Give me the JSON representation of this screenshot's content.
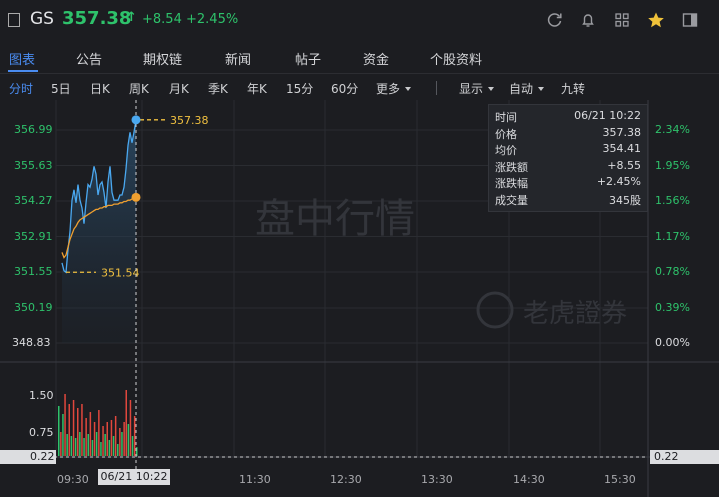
{
  "header": {
    "symbol": "GS",
    "price": "357.38",
    "arrow": "↑",
    "change": "+8.54",
    "change_pct": "+2.45%"
  },
  "tabs": [
    "图表",
    "公告",
    "期权链",
    "新闻",
    "帖子",
    "资金",
    "个股资料"
  ],
  "toolbar": {
    "periods": [
      "分时",
      "5日",
      "日K",
      "周K",
      "月K",
      "季K",
      "年K",
      "15分",
      "60分",
      "更多"
    ],
    "display": "显示",
    "auto": "自动",
    "nine": "九转"
  },
  "watermark": {
    "main": "盘中行情",
    "brand": "老虎證券"
  },
  "y_axis_left": [
    "356.99",
    "355.63",
    "354.27",
    "352.91",
    "351.55",
    "350.19",
    "348.83"
  ],
  "y_axis_right": [
    "2.34%",
    "1.95%",
    "1.56%",
    "1.17%",
    "0.78%",
    "0.39%",
    "0.00%"
  ],
  "volume_axis": [
    "1.50",
    "0.75",
    "0.22"
  ],
  "volume_right": "0.22",
  "x_axis": [
    "09:30",
    "11:30",
    "12:30",
    "13:30",
    "14:30",
    "15:30"
  ],
  "cursor_time": "06/21 10:22",
  "high_marker": "357.38",
  "low_marker": "351.54",
  "info_panel": [
    {
      "k": "时间",
      "v": "06/21 10:22"
    },
    {
      "k": "价格",
      "v": "357.38"
    },
    {
      "k": "均价",
      "v": "354.41"
    },
    {
      "k": "涨跌额",
      "v": "+8.55"
    },
    {
      "k": "涨跌幅",
      "v": "+2.45%"
    },
    {
      "k": "成交量",
      "v": "345股"
    }
  ],
  "chart_data": {
    "type": "line",
    "prev_close": 348.83,
    "ylim": [
      348.83,
      357.7
    ],
    "price": [
      351.9,
      351.6,
      351.54,
      352.4,
      353.1,
      354.3,
      354.7,
      354.2,
      354.9,
      354.3,
      354.0,
      353.4,
      354.2,
      354.9,
      354.8,
      355.1,
      355.6,
      355.3,
      354.5,
      354.9,
      355.0,
      354.6,
      354.0,
      355.0,
      355.6,
      354.6,
      354.3,
      354.3,
      354.3,
      354.5,
      354.5,
      354.8,
      355.5,
      356.4,
      356.9,
      356.5,
      356.9,
      357.38
    ],
    "avg": [
      352.3,
      352.1,
      352.2,
      352.5,
      352.8,
      353.0,
      353.2,
      353.3,
      353.45,
      353.55,
      353.6,
      353.65,
      353.7,
      353.75,
      353.8,
      353.85,
      353.9,
      353.95,
      353.95,
      354.0,
      354.0,
      354.05,
      354.05,
      354.1,
      354.1,
      354.1,
      354.15,
      354.15,
      354.15,
      354.2,
      354.2,
      354.25,
      354.25,
      354.3,
      354.3,
      354.35,
      354.38,
      354.41
    ],
    "volume": [
      1.25,
      0.6,
      1.05,
      1.55,
      0.55,
      1.3,
      0.5,
      1.4,
      0.45,
      1.2,
      0.6,
      1.3,
      0.45,
      0.95,
      0.55,
      1.1,
      0.4,
      0.85,
      0.6,
      1.15,
      0.35,
      0.75,
      0.55,
      0.85,
      0.4,
      0.9,
      0.5,
      1.0,
      0.3,
      0.7,
      0.6,
      0.85,
      1.65,
      0.8,
      1.4,
      0.5,
      1.0,
      0.22
    ],
    "volume_colors": [
      "#2ec26b",
      "#e0473d",
      "#2ec26b",
      "#e0473d",
      "#2ec26b",
      "#e0473d",
      "#2ec26b",
      "#e0473d",
      "#2ec26b",
      "#e0473d",
      "#2ec26b",
      "#e0473d",
      "#2ec26b",
      "#e0473d",
      "#2ec26b",
      "#e0473d",
      "#2ec26b",
      "#e0473d",
      "#2ec26b",
      "#e0473d",
      "#2ec26b",
      "#e0473d",
      "#2ec26b",
      "#e0473d",
      "#2ec26b",
      "#e0473d",
      "#2ec26b",
      "#e0473d",
      "#2ec26b",
      "#e0473d",
      "#2ec26b",
      "#e0473d",
      "#e0473d",
      "#2ec26b",
      "#e0473d",
      "#2ec26b",
      "#e0473d",
      "#2ec26b"
    ]
  },
  "colors": {
    "green": "#2ec26b",
    "blue_line": "#4aa8f0",
    "avg_line": "#f0a030",
    "accent": "#4a8cf0",
    "marker": "#f0c040"
  }
}
